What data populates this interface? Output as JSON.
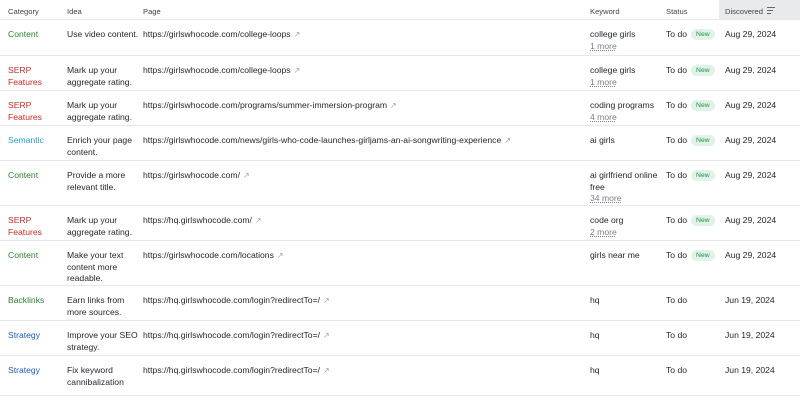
{
  "columns": {
    "category": "Category",
    "idea": "Idea",
    "page": "Page",
    "keyword": "Keyword",
    "status": "Status",
    "discovered": "Discovered"
  },
  "rows": [
    {
      "category": "Content",
      "cat_class": "cat-content",
      "idea": "Use video content.",
      "page": "https://girlswhocode.com/college-loops",
      "keyword": "college girls",
      "more": "1 more",
      "status": "To do",
      "badge": "New",
      "date": "Aug 29, 2024",
      "h": 36
    },
    {
      "category": "SERP Features",
      "cat_class": "cat-serp",
      "idea": "Mark up your aggregate rating.",
      "page": "https://girlswhocode.com/college-loops",
      "keyword": "college girls",
      "more": "1 more",
      "status": "To do",
      "badge": "New",
      "date": "Aug 29, 2024",
      "h": 35
    },
    {
      "category": "SERP Features",
      "cat_class": "cat-serp",
      "idea": "Mark up your aggregate rating.",
      "page": "https://girlswhocode.com/programs/summer-immersion-program",
      "keyword": "coding programs",
      "more": "4 more",
      "status": "To do",
      "badge": "New",
      "date": "Aug 29, 2024",
      "h": 35
    },
    {
      "category": "Semantic",
      "cat_class": "cat-semantic",
      "idea": "Enrich your page content.",
      "page": "https://girlswhocode.com/news/girls-who-code-launches-girljams-an-ai-songwriting-experience",
      "keyword": "ai girls",
      "more": "",
      "status": "To do",
      "badge": "New",
      "date": "Aug 29, 2024",
      "h": 35
    },
    {
      "category": "Content",
      "cat_class": "cat-content",
      "idea": "Provide a more relevant title.",
      "page": "https://girlswhocode.com/",
      "keyword": "ai girlfriend online free",
      "more": "34 more",
      "status": "To do",
      "badge": "New",
      "date": "Aug 29, 2024",
      "h": 45
    },
    {
      "category": "SERP Features",
      "cat_class": "cat-serp",
      "idea": "Mark up your aggregate rating.",
      "page": "https://hq.girlswhocode.com/",
      "keyword": "code org",
      "more": "2 more",
      "status": "To do",
      "badge": "New",
      "date": "Aug 29, 2024",
      "h": 35
    },
    {
      "category": "Content",
      "cat_class": "cat-content",
      "idea": "Make your text content more readable.",
      "page": "https://girlswhocode.com/locations",
      "keyword": "girls near me",
      "more": "",
      "status": "To do",
      "badge": "New",
      "date": "Aug 29, 2024",
      "h": 45
    },
    {
      "category": "Backlinks",
      "cat_class": "cat-backlinks",
      "idea": "Earn links from more sources.",
      "page": "https://hq.girlswhocode.com/login?redirectTo=/",
      "keyword": "hq",
      "more": "",
      "status": "To do",
      "badge": "",
      "date": "Jun 19, 2024",
      "h": 35
    },
    {
      "category": "Strategy",
      "cat_class": "cat-strategy",
      "idea": "Improve your SEO strategy.",
      "page": "https://hq.girlswhocode.com/login?redirectTo=/",
      "keyword": "hq",
      "more": "",
      "status": "To do",
      "badge": "",
      "date": "Jun 19, 2024",
      "h": 35
    },
    {
      "category": "Strategy",
      "cat_class": "cat-strategy",
      "idea": "Fix keyword cannibalization",
      "page": "https://hq.girlswhocode.com/login?redirectTo=/",
      "keyword": "hq",
      "more": "",
      "status": "To do",
      "badge": "",
      "date": "Jun 19, 2024",
      "h": 40
    }
  ]
}
